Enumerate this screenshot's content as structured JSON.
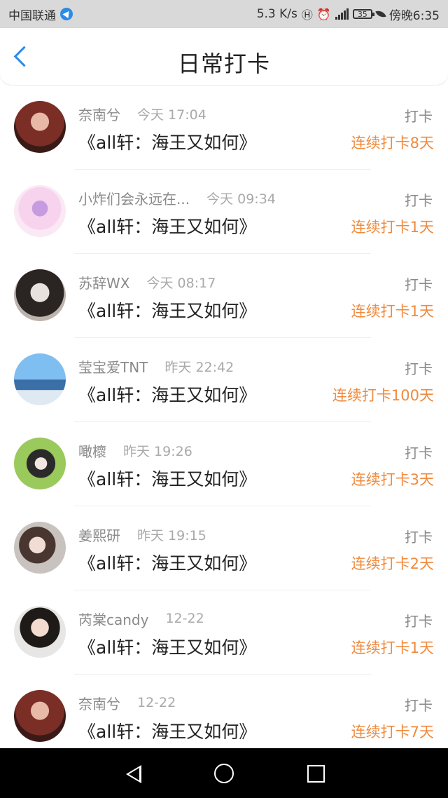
{
  "status_bar": {
    "carrier": "中国联通",
    "speed": "5.3 K/s",
    "battery": "35",
    "time": "傍晚6:35",
    "network": "4G"
  },
  "header": {
    "title": "日常打卡"
  },
  "colors": {
    "accent": "#2b8be6",
    "streak": "#f08a3d"
  },
  "items": [
    {
      "name": "奈南兮",
      "time": "今天 17:04",
      "title": "《all轩：海王又如何》",
      "action": "打卡",
      "streak": "连续打卡8天"
    },
    {
      "name": "小炸们会永远在...",
      "time": "今天 09:34",
      "title": "《all轩：海王又如何》",
      "action": "打卡",
      "streak": "连续打卡1天"
    },
    {
      "name": "苏辞WX",
      "time": "今天 08:17",
      "title": "《all轩：海王又如何》",
      "action": "打卡",
      "streak": "连续打卡1天"
    },
    {
      "name": "莹宝爱TNT",
      "time": "昨天 22:42",
      "title": "《all轩：海王又如何》",
      "action": "打卡",
      "streak": "连续打卡100天"
    },
    {
      "name": "噉櫰",
      "time": "昨天 19:26",
      "title": "《all轩：海王又如何》",
      "action": "打卡",
      "streak": "连续打卡3天"
    },
    {
      "name": "姜熙研",
      "time": "昨天 19:15",
      "title": "《all轩：海王又如何》",
      "action": "打卡",
      "streak": "连续打卡2天"
    },
    {
      "name": "芮棠candy",
      "time": "12-22",
      "title": "《all轩：海王又如何》",
      "action": "打卡",
      "streak": "连续打卡1天"
    },
    {
      "name": "奈南兮",
      "time": "12-22",
      "title": "《all轩：海王又如何》",
      "action": "打卡",
      "streak": "连续打卡7天"
    }
  ],
  "nav": {
    "back_icon": "triangle-back-icon",
    "home_icon": "circle-home-icon",
    "recent_icon": "square-recent-icon"
  }
}
